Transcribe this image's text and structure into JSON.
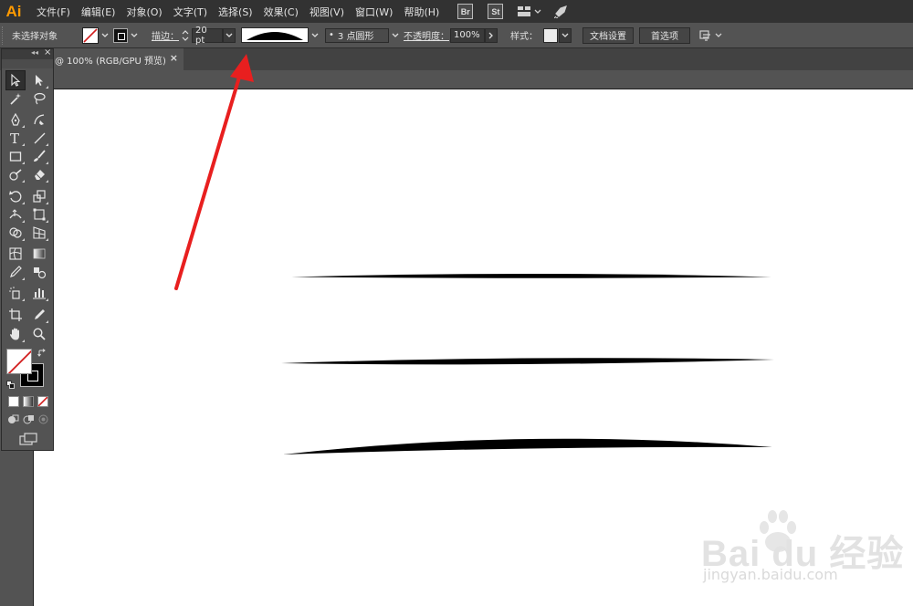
{
  "app": {
    "logo": "Ai"
  },
  "menu": {
    "items": [
      "文件(F)",
      "编辑(E)",
      "对象(O)",
      "文字(T)",
      "选择(S)",
      "效果(C)",
      "视图(V)",
      "窗口(W)",
      "帮助(H)"
    ],
    "badges": {
      "bridge": "Br",
      "stock": "St"
    },
    "icons": {
      "workspace": "workspace-switcher-icon",
      "publish": "rocket-icon"
    }
  },
  "control_bar": {
    "selection_status": "未选择对象",
    "stroke_label": "描边：",
    "stroke_weight": "20 pt",
    "brush_label": "3 点圆形",
    "opacity_label": "不透明度：",
    "opacity_value": "100%",
    "style_label": "样式：",
    "doc_setup_button": "文档设置",
    "preferences_button": "首选项"
  },
  "document": {
    "tab_title": "@ 100% (RGB/GPU 预览)",
    "close_glyph": "×"
  },
  "tools_panel": {
    "collapse_glyph": "◂◂",
    "close_glyph": "×"
  },
  "annotation": {
    "arrow_color": "#e81f1f"
  },
  "watermark": {
    "brand": "Bai  du 经验",
    "url": "jingyan.baidu.com"
  },
  "colors": {
    "accent_logo": "#ff9a00",
    "ui_dark": "#323232",
    "ui_mid": "#535353",
    "artboard": "#ffffff"
  }
}
